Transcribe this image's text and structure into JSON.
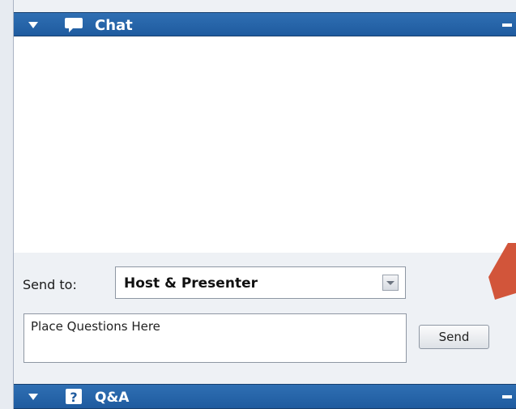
{
  "chat_panel": {
    "title": "Chat",
    "icon": "speech-bubble-icon",
    "collapse_icon": "triangle-down-icon",
    "minimize_icon": "minimize-icon"
  },
  "compose": {
    "send_to_label": "Send to:",
    "recipient_selected": "Host & Presenter",
    "message_placeholder": "Place Questions Here",
    "send_label": "Send"
  },
  "qa_panel": {
    "title": "Q&A",
    "icon": "question-mark-icon",
    "collapse_icon": "triangle-down-icon",
    "minimize_icon": "minimize-icon"
  },
  "colors": {
    "header_blue": "#1f5b9f",
    "annotation_arrow": "#d2553a"
  }
}
